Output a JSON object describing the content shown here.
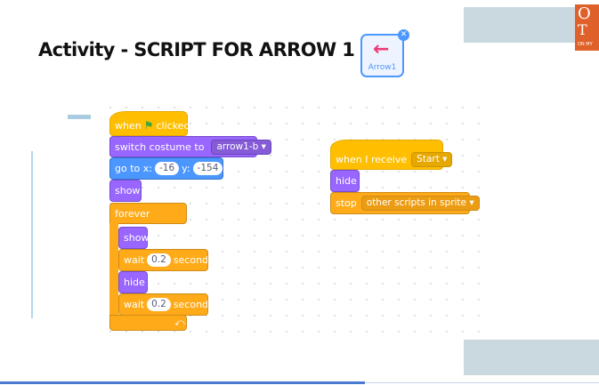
{
  "slide": {
    "title": "Activity  - SCRIPT FOR ARROW 1",
    "logo_line1": "O",
    "logo_line2": "T",
    "logo_line3": "ON MY"
  },
  "sprite": {
    "name": "Arrow1",
    "icon": "arrow-left-icon",
    "close_icon": "close-icon",
    "arrow_color": "#ee3b77"
  },
  "script1": {
    "when_flag": {
      "prefix": "when",
      "suffix": "clicked"
    },
    "switch_costume": {
      "label": "switch costume to",
      "value": "arrow1-b"
    },
    "go_to": {
      "label": "go to x:",
      "x": "-16",
      "ylabel": "y:",
      "y": "-154"
    },
    "show1": "show",
    "forever": "forever",
    "show2": "show",
    "wait1": {
      "label": "wait",
      "value": "0.2",
      "unit": "seconds"
    },
    "hide": "hide",
    "wait2": {
      "label": "wait",
      "value": "0.2",
      "unit": "seconds"
    },
    "loop_icon": "loop-arrow-icon"
  },
  "script2": {
    "when_receive": {
      "label": "when I receive",
      "value": "Start"
    },
    "hide": "hide",
    "stop": {
      "label": "stop",
      "value": "other scripts in sprite"
    }
  },
  "colors": {
    "events": "#ffbf00",
    "looks": "#9966ff",
    "motion": "#4c97ff",
    "control": "#ffab19"
  }
}
